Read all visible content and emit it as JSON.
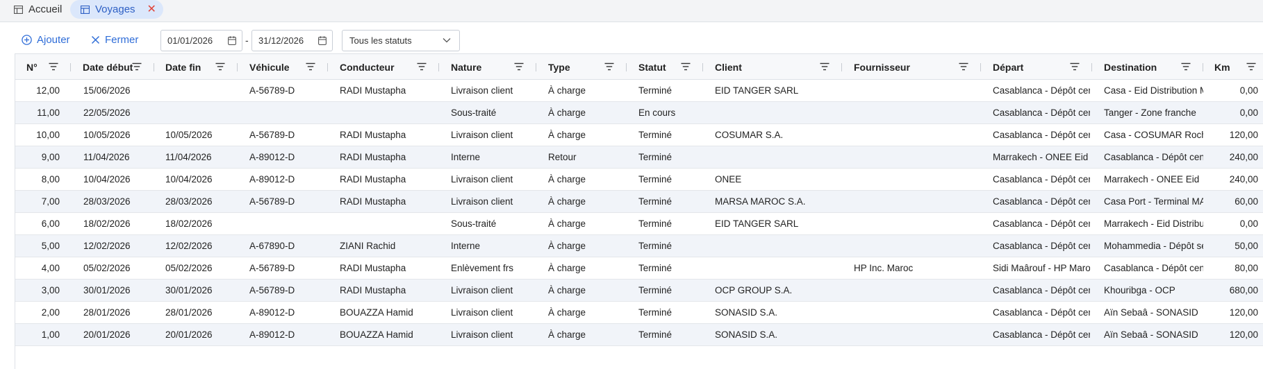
{
  "tabs": [
    {
      "label": "Accueil",
      "icon": "table-icon"
    },
    {
      "label": "Voyages",
      "icon": "table-icon",
      "close_glyph": "✕"
    }
  ],
  "toolbar": {
    "add_label": "Ajouter",
    "close_label": "Fermer",
    "date_from": "01/01/2026",
    "date_separator": "-",
    "date_to": "31/12/2026",
    "status_filter": "Tous les statuts"
  },
  "colors": {
    "accent": "#2f6dd8",
    "tab_active_bg": "#dbe7fb",
    "close_red": "#e0453a",
    "row_alt": "#f1f4f9"
  },
  "columns": [
    "N°",
    "Date début",
    "Date fin",
    "Véhicule",
    "Conducteur",
    "Nature",
    "Type",
    "Statut",
    "Client",
    "Fournisseur",
    "Départ",
    "Destination",
    "Km"
  ],
  "rows": [
    [
      "12,00",
      "15/06/2026",
      "",
      "A-56789-D",
      "RADI Mustapha",
      "Livraison client",
      "À charge",
      "Terminé",
      "EID TANGER SARL",
      "",
      "Casablanca - Dépôt central",
      "Casa - Eid Distribution M",
      "0,00"
    ],
    [
      "11,00",
      "22/05/2026",
      "",
      "",
      "",
      "Sous-traité",
      "À charge",
      "En cours",
      "",
      "",
      "Casablanca - Dépôt central",
      "Tanger - Zone franche",
      "0,00"
    ],
    [
      "10,00",
      "10/05/2026",
      "10/05/2026",
      "A-56789-D",
      "RADI Mustapha",
      "Livraison client",
      "À charge",
      "Terminé",
      "COSUMAR S.A.",
      "",
      "Casablanca - Dépôt central",
      "Casa - COSUMAR Roches",
      "120,00"
    ],
    [
      "9,00",
      "11/04/2026",
      "11/04/2026",
      "A-89012-D",
      "RADI Mustapha",
      "Interne",
      "Retour",
      "Terminé",
      "",
      "",
      "Marrakech - ONEE Eid",
      "Casablanca - Dépôt central",
      "240,00"
    ],
    [
      "8,00",
      "10/04/2026",
      "10/04/2026",
      "A-89012-D",
      "RADI Mustapha",
      "Livraison client",
      "À charge",
      "Terminé",
      "ONEE",
      "",
      "Casablanca - Dépôt central",
      "Marrakech - ONEE Eid",
      "240,00"
    ],
    [
      "7,00",
      "28/03/2026",
      "28/03/2026",
      "A-56789-D",
      "RADI Mustapha",
      "Livraison client",
      "À charge",
      "Terminé",
      "MARSA MAROC S.A.",
      "",
      "Casablanca - Dépôt central",
      "Casa Port - Terminal MAF",
      "60,00"
    ],
    [
      "6,00",
      "18/02/2026",
      "18/02/2026",
      "",
      "",
      "Sous-traité",
      "À charge",
      "Terminé",
      "EID TANGER SARL",
      "",
      "Casablanca - Dépôt central",
      "Marrakech - Eid Distribut",
      "0,00"
    ],
    [
      "5,00",
      "12/02/2026",
      "12/02/2026",
      "A-67890-D",
      "ZIANI Rachid",
      "Interne",
      "À charge",
      "Terminé",
      "",
      "",
      "Casablanca - Dépôt central",
      "Mohammedia - Dépôt se",
      "50,00"
    ],
    [
      "4,00",
      "05/02/2026",
      "05/02/2026",
      "A-56789-D",
      "RADI Mustapha",
      "Enlèvement frs",
      "À charge",
      "Terminé",
      "",
      "HP Inc. Maroc",
      "Sidi Maârouf - HP Maroc",
      "Casablanca - Dépôt central",
      "80,00"
    ],
    [
      "3,00",
      "30/01/2026",
      "30/01/2026",
      "A-56789-D",
      "RADI Mustapha",
      "Livraison client",
      "À charge",
      "Terminé",
      "OCP GROUP S.A.",
      "",
      "Casablanca - Dépôt central",
      "Khouribga - OCP",
      "680,00"
    ],
    [
      "2,00",
      "28/01/2026",
      "28/01/2026",
      "A-89012-D",
      "BOUAZZA Hamid",
      "Livraison client",
      "À charge",
      "Terminé",
      "SONASID S.A.",
      "",
      "Casablanca - Dépôt central",
      "Aïn Sebaâ - SONASID",
      "120,00"
    ],
    [
      "1,00",
      "20/01/2026",
      "20/01/2026",
      "A-89012-D",
      "BOUAZZA Hamid",
      "Livraison client",
      "À charge",
      "Terminé",
      "SONASID S.A.",
      "",
      "Casablanca - Dépôt central",
      "Aïn Sebaâ - SONASID",
      "120,00"
    ]
  ]
}
